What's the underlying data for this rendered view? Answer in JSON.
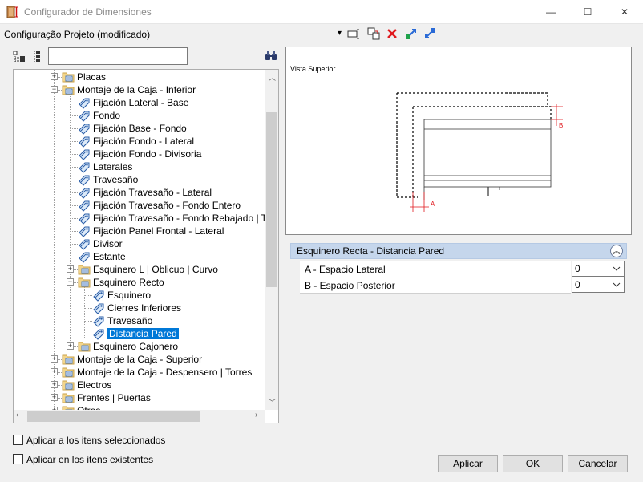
{
  "window": {
    "title": "Configurador de Dimensiones",
    "minimize_glyph": "—",
    "maximize_glyph": "☐",
    "close_glyph": "✕"
  },
  "config": {
    "current": "Configuração Projeto (modificado)",
    "dropdown_glyph": "▾"
  },
  "toolbar": {
    "icons": [
      "rename-icon",
      "copy-config-icon",
      "delete-icon",
      "export-icon",
      "import-icon"
    ]
  },
  "tree": {
    "search_value": "",
    "items": [
      {
        "label": "Placas"
      },
      {
        "label": "Montaje de la Caja - Inferior"
      },
      {
        "label": "Fijación Lateral - Base"
      },
      {
        "label": "Fondo"
      },
      {
        "label": " Fijación Base - Fondo"
      },
      {
        "label": "Fijación Fondo - Lateral"
      },
      {
        "label": "Fijación Fondo - Divisoria"
      },
      {
        "label": "Laterales"
      },
      {
        "label": "Travesaño"
      },
      {
        "label": "Fijación Travesaño - Lateral"
      },
      {
        "label": "Fijación Travesaño - Fondo Entero"
      },
      {
        "label": "Fijación Travesaño - Fondo Rebajado | Travesaño"
      },
      {
        "label": "Fijación Panel Frontal - Lateral"
      },
      {
        "label": "Divisor"
      },
      {
        "label": "Estante"
      },
      {
        "label": "Esquinero L | Oblicuo | Curvo"
      },
      {
        "label": "Esquinero Recto"
      },
      {
        "label": "Esquinero"
      },
      {
        "label": "Cierres Inferiores"
      },
      {
        "label": "Travesaño"
      },
      {
        "label": "Distancia Pared"
      },
      {
        "label": "Esquinero Cajonero"
      },
      {
        "label": "Montaje de la Caja - Superior"
      },
      {
        "label": "Montaje de la Caja - Despensero | Torres"
      },
      {
        "label": "Electros"
      },
      {
        "label": "Frentes | Puertas"
      },
      {
        "label": "Otros"
      }
    ]
  },
  "preview": {
    "view_label": "Vista Superior",
    "dim_a": "A",
    "dim_b": "B",
    "accent_color": "#e0191e"
  },
  "properties": {
    "section_title": "Esquinero Recta - Distancia Pared",
    "collapse_glyph": "︽",
    "rows": [
      {
        "label": "A - Espacio Lateral",
        "value": "0"
      },
      {
        "label": "B - Espacio Posterior",
        "value": "0"
      }
    ]
  },
  "options": {
    "apply_selected": "Aplicar a los itens seleccionados",
    "apply_existing": "Aplicar en los itens existentes"
  },
  "buttons": {
    "apply": "Aplicar",
    "ok": "OK",
    "cancel": "Cancelar"
  }
}
